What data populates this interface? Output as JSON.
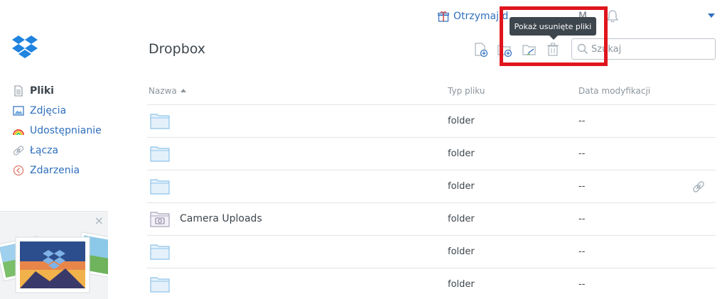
{
  "topbar": {
    "promo_text": "Otrzymaj d",
    "avatar_letter": "M"
  },
  "header": {
    "title": "Dropbox",
    "search_placeholder": "Szukaj"
  },
  "tooltip": {
    "text": "Pokaż usunięte pliki"
  },
  "sidebar": {
    "items": [
      {
        "label": "Pliki",
        "icon": "files-icon",
        "active": true
      },
      {
        "label": "Zdjęcia",
        "icon": "photos-icon",
        "active": false
      },
      {
        "label": "Udostępnianie",
        "icon": "sharing-icon",
        "active": false
      },
      {
        "label": "Łącza",
        "icon": "links-icon",
        "active": false
      },
      {
        "label": "Zdarzenia",
        "icon": "events-icon",
        "active": false
      }
    ],
    "promo_close": "×"
  },
  "table": {
    "columns": {
      "name": "Nazwa",
      "type": "Typ pliku",
      "modified": "Data modyfikacji"
    },
    "rows": [
      {
        "name": "",
        "type": "folder",
        "modified": "--",
        "icon": "folder-icon"
      },
      {
        "name": "",
        "type": "folder",
        "modified": "--",
        "icon": "folder-icon"
      },
      {
        "name": "",
        "type": "folder",
        "modified": "--",
        "icon": "folder-icon"
      },
      {
        "name": "Camera Uploads",
        "type": "folder",
        "modified": "--",
        "icon": "camera-folder-icon"
      },
      {
        "name": "",
        "type": "folder",
        "modified": "--",
        "icon": "folder-icon"
      },
      {
        "name": "",
        "type": "folder",
        "modified": "--",
        "icon": "folder-icon"
      }
    ]
  },
  "colors": {
    "accent": "#2f6fbd",
    "highlight": "#e0151d",
    "tooltip_bg": "#3d464d",
    "text": "#3d464d",
    "folder": "#a8d2f0"
  }
}
